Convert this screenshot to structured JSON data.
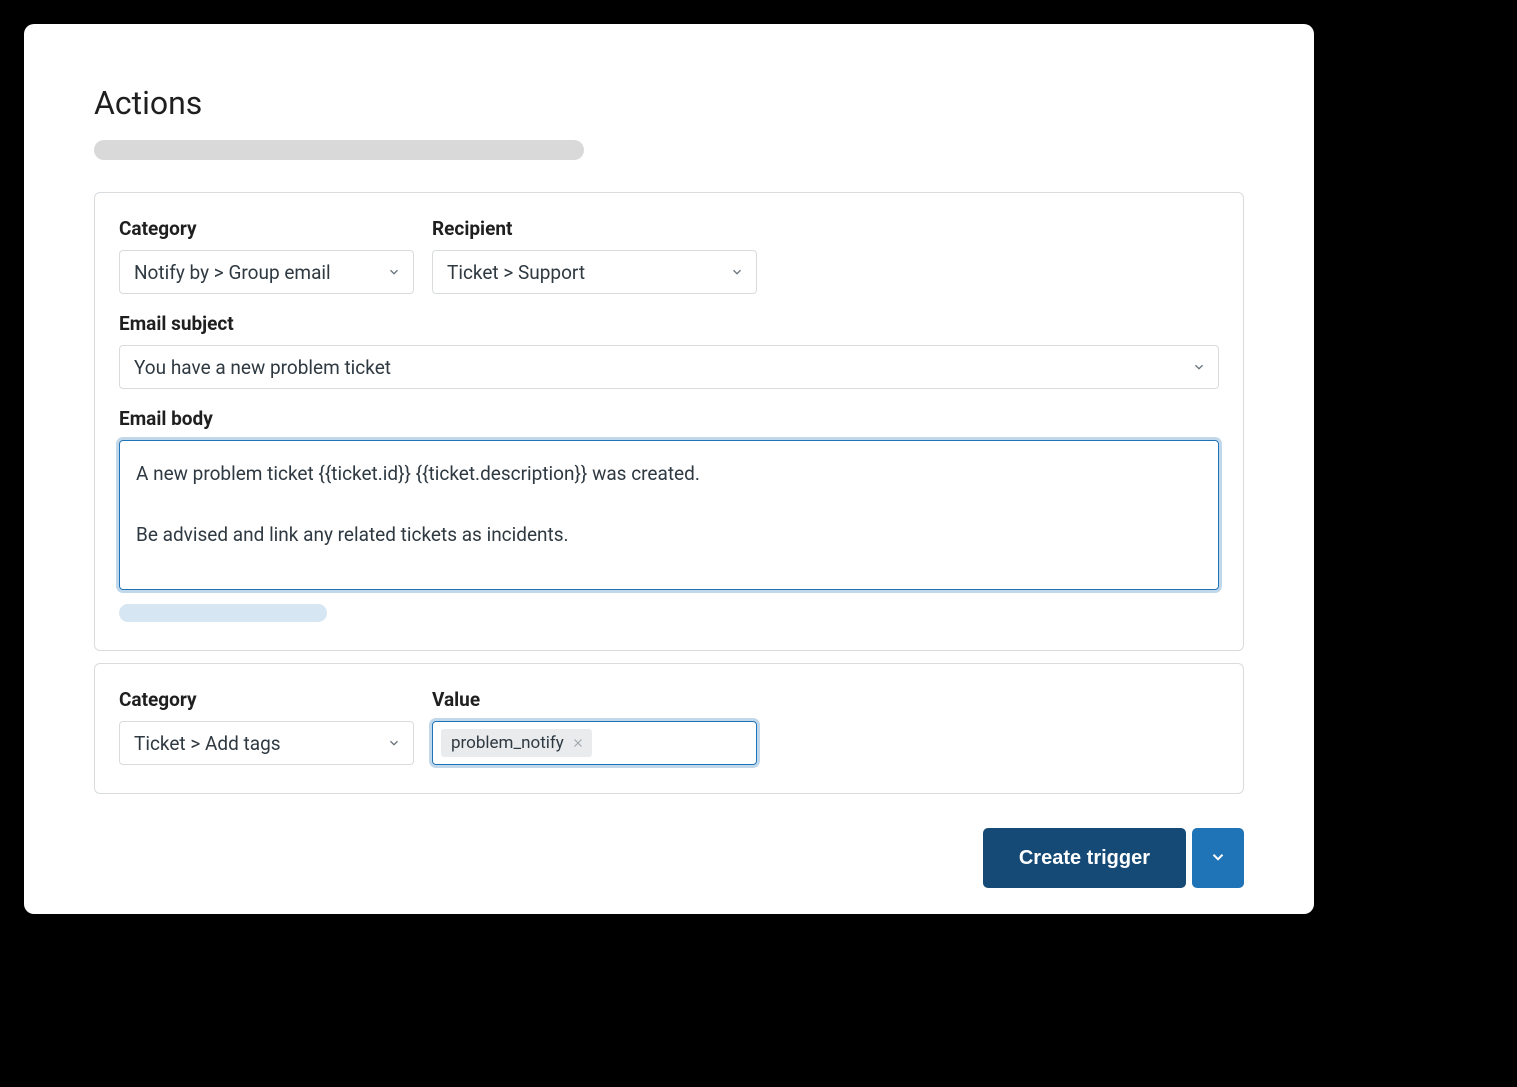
{
  "section_title": "Actions",
  "action1": {
    "category_label": "Category",
    "category_value": "Notify by > Group email",
    "recipient_label": "Recipient",
    "recipient_value": "Ticket > Support",
    "subject_label": "Email subject",
    "subject_value": "You have a new problem ticket",
    "body_label": "Email body",
    "body_value": "A new problem ticket {{ticket.id}} {{ticket.description}} was created.\n\nBe advised and link any related tickets as incidents."
  },
  "action2": {
    "category_label": "Category",
    "category_value": "Ticket > Add tags",
    "value_label": "Value",
    "tag": "problem_notify"
  },
  "footer": {
    "submit_label": "Create trigger"
  }
}
